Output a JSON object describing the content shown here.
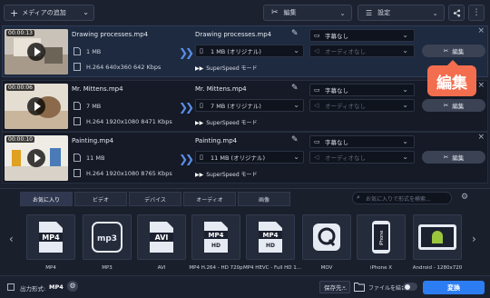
{
  "toolbar": {
    "add_media_label": "メディアの追加",
    "edit_label": "編集",
    "settings_label": "設定"
  },
  "files": [
    {
      "duration": "00:00:13",
      "name": "Drawing processes.mp4",
      "size": "1 MB",
      "info": "H.264 640x360 642 Kbps",
      "output_name": "Drawing processes.mp4",
      "output_size": "1 MB (オリジナル)",
      "superspeed": "SuperSpeed モード",
      "subtitles": "字幕なし",
      "audio": "オーディオなし",
      "edit_label": "編集"
    },
    {
      "duration": "00:00:06",
      "name": "Mr. Mittens.mp4",
      "size": "7 MB",
      "info": "H.264 1920x1080 8471 Kbps",
      "output_name": "Mr. Mittens.mp4",
      "output_size": "7 MB (オリジナル)",
      "superspeed": "SuperSpeed モード",
      "subtitles": "字幕なし",
      "audio": "オーディオなし",
      "edit_label": "編集"
    },
    {
      "duration": "00:00:10",
      "name": "Painting.mp4",
      "size": "11 MB",
      "info": "H.264 1920x1080 8765 Kbps",
      "output_name": "Painting.mp4",
      "output_size": "11 MB (オリジナル)",
      "superspeed": "SuperSpeed モード",
      "subtitles": "字幕なし",
      "audio": "オーディオなし",
      "edit_label": "編集"
    }
  ],
  "tooltip": "編集",
  "formats_panel": {
    "tabs": [
      "お気に入り",
      "ビデオ",
      "デバイス",
      "オーディオ",
      "画像"
    ],
    "active_tab": 0,
    "search_placeholder": "お気に入りで形式を検索...",
    "items": [
      {
        "label": "MP4",
        "icon": "mp4-icon"
      },
      {
        "label": "MP3",
        "icon": "mp3-icon"
      },
      {
        "label": "AVI",
        "icon": "avi-icon"
      },
      {
        "label": "MP4 H.264 - HD 720p",
        "icon": "mp4-hd-icon"
      },
      {
        "label": "MP4 HEVC - Full HD 1...",
        "icon": "mp4-hevc-icon"
      },
      {
        "label": "MOV",
        "icon": "mov-icon"
      },
      {
        "label": "iPhone X",
        "icon": "iphone-icon"
      },
      {
        "label": "Android - 1280x720",
        "icon": "android-icon"
      }
    ]
  },
  "footer": {
    "output_format_label": "出力形式:",
    "output_format_value": "MP4",
    "save_label": "保存先...",
    "merge_label": "ファイルを結合:",
    "merge_enabled": false,
    "convert_label": "変換"
  },
  "colors": {
    "accent": "#2d7df2",
    "tooltip": "#f36e4e",
    "background": "#1c2130"
  }
}
